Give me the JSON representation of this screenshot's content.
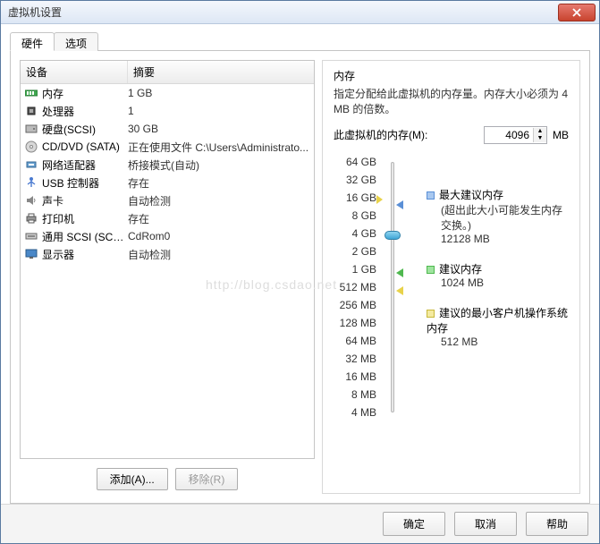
{
  "window": {
    "title": "虚拟机设置"
  },
  "tabs": {
    "hardware": "硬件",
    "options": "选项"
  },
  "hwlist": {
    "header_device": "设备",
    "header_summary": "摘要",
    "rows": [
      {
        "icon": "memory-icon",
        "name": "内存",
        "summary": "1 GB"
      },
      {
        "icon": "cpu-icon",
        "name": "处理器",
        "summary": "1"
      },
      {
        "icon": "disk-icon",
        "name": "硬盘(SCSI)",
        "summary": "30 GB"
      },
      {
        "icon": "cd-icon",
        "name": "CD/DVD (SATA)",
        "summary": "正在使用文件 C:\\Users\\Administrato..."
      },
      {
        "icon": "nic-icon",
        "name": "网络适配器",
        "summary": "桥接模式(自动)"
      },
      {
        "icon": "usb-icon",
        "name": "USB 控制器",
        "summary": "存在"
      },
      {
        "icon": "sound-icon",
        "name": "声卡",
        "summary": "自动检测"
      },
      {
        "icon": "printer-icon",
        "name": "打印机",
        "summary": "存在"
      },
      {
        "icon": "scsi-icon",
        "name": "通用 SCSI (SCSI ...",
        "summary": "CdRom0"
      },
      {
        "icon": "display-icon",
        "name": "显示器",
        "summary": "自动检测"
      }
    ]
  },
  "leftbtns": {
    "add": "添加(A)...",
    "remove": "移除(R)"
  },
  "right": {
    "title": "内存",
    "desc": "指定分配给此虚拟机的内存量。内存大小必须为 4 MB 的倍数。",
    "memlabel": "此虚拟机的内存(M):",
    "value": "4096",
    "unit": "MB",
    "ticks": [
      "64 GB",
      "32 GB",
      "16 GB",
      "8 GB",
      "4 GB",
      "2 GB",
      "1 GB",
      "512 MB",
      "256 MB",
      "128 MB",
      "64 MB",
      "32 MB",
      "16 MB",
      "8 MB",
      "4 MB"
    ],
    "legend": {
      "max_label": "最大建议内存",
      "max_note": "(超出此大小可能发生内存交换。)",
      "max_val": "12128 MB",
      "rec_label": "建议内存",
      "rec_val": "1024 MB",
      "min_label": "建议的最小客户机操作系统内存",
      "min_val": "512 MB"
    }
  },
  "footer": {
    "ok": "确定",
    "cancel": "取消",
    "help": "帮助"
  },
  "watermark": "http://blog.csdao.net"
}
